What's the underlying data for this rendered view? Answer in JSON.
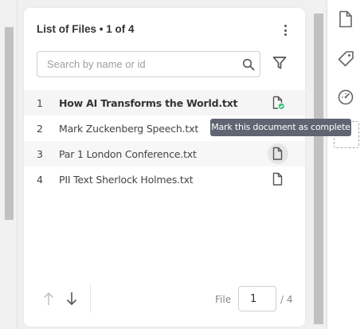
{
  "panel": {
    "title": "List of Files • 1 of 4"
  },
  "search": {
    "placeholder": "Search by name or id",
    "value": ""
  },
  "files": [
    {
      "num": "1",
      "name": "How AI Transforms the World.txt",
      "status": "complete"
    },
    {
      "num": "2",
      "name": "Mark Zuckenberg Speech.txt",
      "status": "pending"
    },
    {
      "num": "3",
      "name": "Par 1 London Conference.txt",
      "status": "pending"
    },
    {
      "num": "4",
      "name": "PII Text Sherlock Holmes.txt",
      "status": "pending"
    }
  ],
  "tooltip": {
    "text": "Mark this document as complete"
  },
  "pagination": {
    "label": "File",
    "current": "1",
    "total": "/ 4"
  },
  "colors": {
    "complete_check": "#3dbf7a",
    "tooltip_bg": "#5f6672",
    "icon": "#555555"
  },
  "icons": {
    "rail": [
      "document-icon",
      "tag-icon",
      "speedometer-icon"
    ]
  }
}
